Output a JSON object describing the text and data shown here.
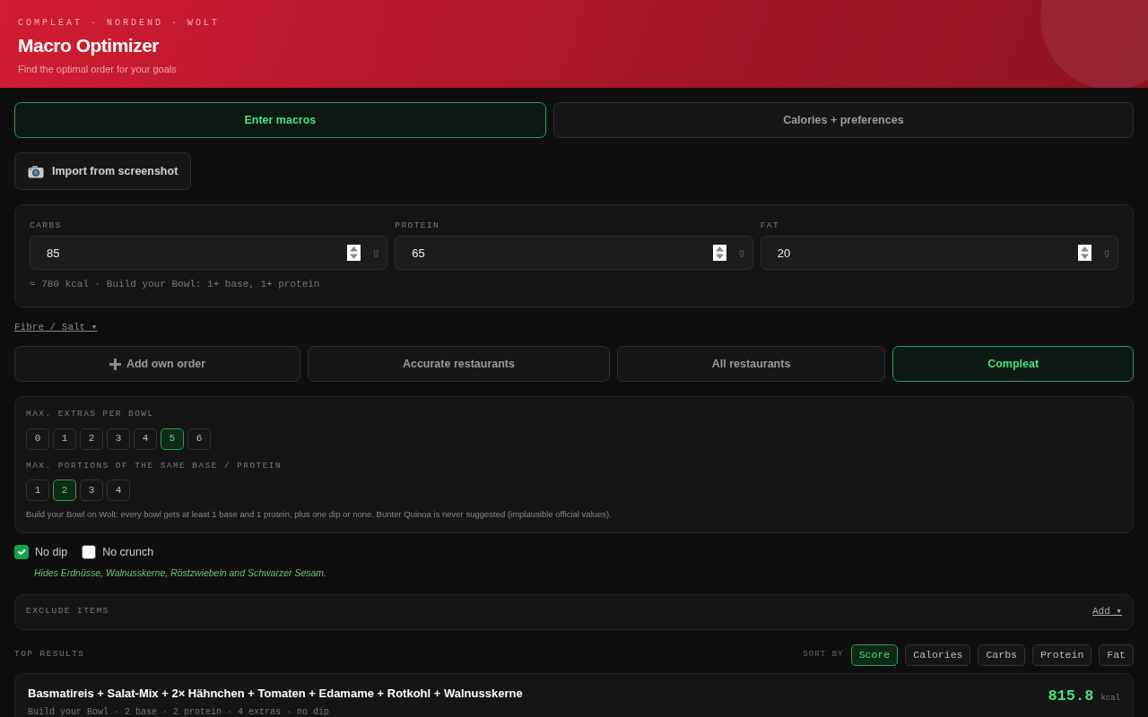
{
  "header": {
    "kicker": "COMPLEAT · NORDEND · WOLT",
    "title": "Macro Optimizer",
    "subtitle": "Find the optimal order for your goals"
  },
  "mode_tabs": [
    {
      "label": "Enter macros",
      "selected": true
    },
    {
      "label": "Calories + preferences",
      "selected": false
    }
  ],
  "import_button": {
    "label": "Import from screenshot"
  },
  "macros": [
    {
      "label": "CARBS",
      "value": "85",
      "unit": "g"
    },
    {
      "label": "PROTEIN",
      "value": "65",
      "unit": "g"
    },
    {
      "label": "FAT",
      "value": "20",
      "unit": "g"
    }
  ],
  "macro_summary": "≈ 780 kcal · Build your Bowl: 1+ base, 1+ protein",
  "fibre_toggle": "Fibre / Salt ▾",
  "source_tabs": [
    {
      "label": "Add own order",
      "kind": "add",
      "selected": false
    },
    {
      "label": "Accurate restaurants",
      "kind": "filter",
      "selected": false
    },
    {
      "label": "All restaurants",
      "kind": "filter",
      "selected": false
    },
    {
      "label": "Compleat",
      "kind": "filter",
      "selected": true
    }
  ],
  "options": {
    "groups": [
      {
        "label": "MAX. EXTRAS PER BOWL",
        "choices": [
          {
            "label": "0",
            "selected": false
          },
          {
            "label": "1",
            "selected": false
          },
          {
            "label": "2",
            "selected": false
          },
          {
            "label": "3",
            "selected": false
          },
          {
            "label": "4",
            "selected": false
          },
          {
            "label": "5",
            "selected": true
          },
          {
            "label": "6",
            "selected": false
          }
        ]
      },
      {
        "label": "MAX. PORTIONS OF THE SAME BASE / PROTEIN",
        "choices": [
          {
            "label": "1",
            "selected": false
          },
          {
            "label": "2",
            "selected": true
          },
          {
            "label": "3",
            "selected": false
          },
          {
            "label": "4",
            "selected": false
          }
        ]
      }
    ],
    "note": "Build your Bowl on Wolt: every bowl gets at least 1 base and 1 protein, plus one dip or none. Bunter Quinoa is never suggested (implausible official values)."
  },
  "checkboxes": [
    {
      "label": "No dip",
      "checked": true
    },
    {
      "label": "No crunch",
      "checked": false
    }
  ],
  "checkbox_hint": "Hides Erdnüsse, Walnusskerne, Röstzwiebeln and Schwarzer Sesam.",
  "exclude": {
    "label": "EXCLUDE ITEMS",
    "action": "Add ▾"
  },
  "results": {
    "heading": "TOP RESULTS",
    "sort_label": "SORT BY",
    "sort_options": [
      {
        "label": "Score",
        "selected": true
      },
      {
        "label": "Calories",
        "selected": false
      },
      {
        "label": "Carbs",
        "selected": false
      },
      {
        "label": "Protein",
        "selected": false
      },
      {
        "label": "Fat",
        "selected": false
      }
    ],
    "items": [
      {
        "title": "Basmatireis + Salat-Mix + 2× Hähnchen + Tomaten + Edamame + Rotkohl + Walnusskerne",
        "meta": "Build your Bowl · 2 base · 2 protein · 4 extras · no dip",
        "kcal": "815.8",
        "unit": "kcal"
      }
    ]
  }
}
